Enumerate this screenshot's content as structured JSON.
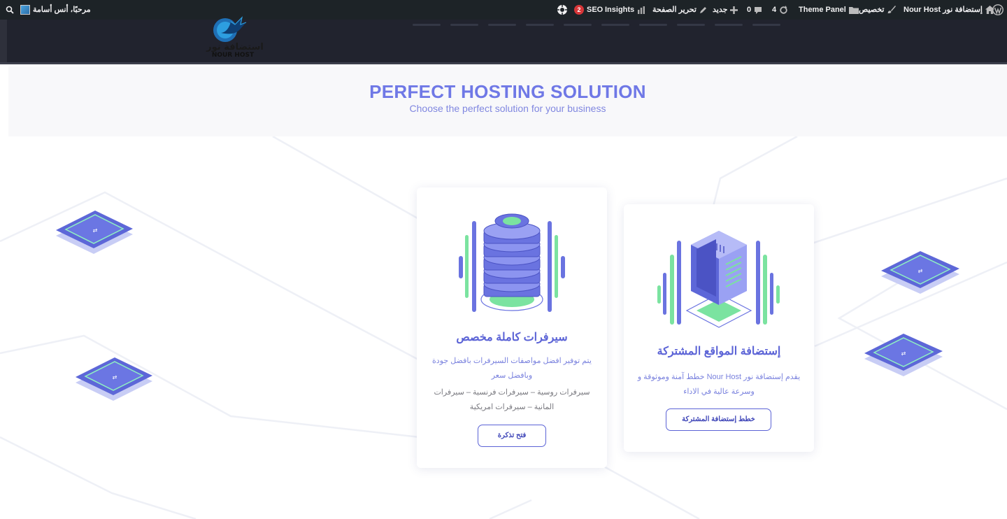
{
  "admin_bar": {
    "site_name": "إستضافة نور Nour Host",
    "customize": "تخصيص",
    "theme_panel": "Theme Panel",
    "updates_count": "4",
    "comments_count": "0",
    "new": "جديد",
    "edit_page": "تحرير الصفحة",
    "insights": "Insights",
    "seo": "SEO",
    "seo_badge": "2",
    "greeting": "مرحبًا، أنس أسامة"
  },
  "header": {
    "logo_text": "استضافة نور",
    "logo_sub": "NOUR HOST"
  },
  "hero": {
    "title": "PERFECT HOSTING SOLUTION",
    "subtitle": "Choose the perfect solution for your business"
  },
  "cards": [
    {
      "title": "سيرفرات كاملة مخصص",
      "text1": "يتم توفير افضل مواصفات السيرفرات بافضل جودة وبافضل سعر",
      "text2": "سيرفرات روسية – سيرفرات فرنسية – سيرفرات المانية – سيرفرات امريكية",
      "button": "فتح تذكرة"
    },
    {
      "title": "إستضافة المواقع المشتركة",
      "text1": "يقدم إستضافة نور Nour Host خطط آمنة وموثوقة و وسرعة عالية في الاداء",
      "button": "خطط إستضافة المشتركة"
    }
  ],
  "colors": {
    "accent": "#6f78e6",
    "admin_bar": "#1d2327",
    "header": "#21232e",
    "green": "#7be3a0"
  }
}
